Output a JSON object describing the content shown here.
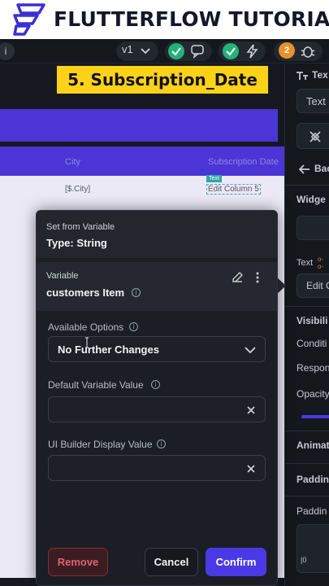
{
  "banner": {
    "title": "FLUTTERFLOW TUTORIAL"
  },
  "toolbar": {
    "version": "v1",
    "badge_count": "2"
  },
  "step_label": "5. Subscription_Date",
  "table": {
    "columns": [
      "City",
      "Subscription Date"
    ],
    "row": [
      "[$.City]",
      "Edit Column 5"
    ],
    "tag": "Text"
  },
  "right_panel": {
    "header": "Tex",
    "text_field": "Text",
    "back": "Bac",
    "widget": "Widge",
    "text_label": "Text",
    "edit_box": "Edit C",
    "visibility": "Visibili",
    "condition": "Conditi",
    "responsive": "Respon",
    "opacity": "Opacity",
    "animation": "Animat",
    "padding": "Paddin",
    "padding2": "Paddin"
  },
  "modal": {
    "set_from": "Set from Variable",
    "type": "Type: String",
    "variable_label": "Variable",
    "variable_value": "customers Item",
    "available_options_label": "Available Options",
    "available_options_value": "No Further Changes",
    "default_value_label": "Default Variable Value",
    "default_value": "",
    "ui_builder_label": "UI Builder Display Value",
    "ui_builder_value": "",
    "remove": "Remove",
    "cancel": "Cancel",
    "confirm": "Confirm"
  },
  "colors": {
    "accent": "#4b39e6",
    "step_label_bg": "#ffd21a",
    "remove": "#e2606e",
    "check": "#23b27a"
  }
}
